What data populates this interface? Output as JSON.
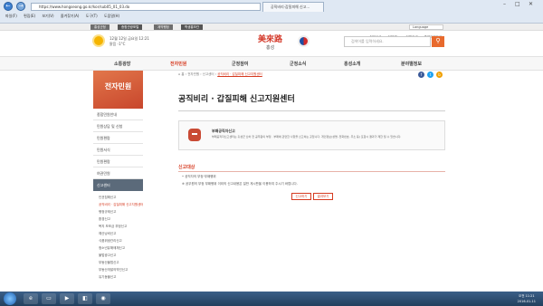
{
  "browser": {
    "back": "←",
    "forward": "→",
    "address": "https://www.hongseong.go.kr/kor/sub05_01_03.do",
    "tab_title": "공직비리·갑질피해 신고...",
    "min": "–",
    "max": "□",
    "close": "✕",
    "menu": [
      "파일(F)",
      "편집(E)",
      "보기(V)",
      "즐겨찾기(A)",
      "도구(T)",
      "도움말(H)"
    ]
  },
  "utilbar": {
    "links": [
      "홍성군청",
      "종합관광포털",
      "계약행정",
      "학생홍보관"
    ],
    "language": "Language"
  },
  "header": {
    "weather_date": "12월 12일 금요일 12:21",
    "weather_temp": "맑음 -1°C",
    "logo_main": "美來路",
    "logo_sub": "홍성",
    "top_links": [
      "처음으로",
      "전체메뉴",
      "직원검색",
      "홈페이지안내"
    ],
    "search_placeholder": "검색어를 입력하세요.",
    "search_icon": "⚲"
  },
  "gnb": [
    "소통광장",
    "전자민원",
    "군정참여",
    "군정소식",
    "홍성소개",
    "분야별정보"
  ],
  "side": {
    "hero_title": "전자민원",
    "menu": [
      "종합민원안내",
      "민원상담 및 신청",
      "민원편람",
      "민원서식",
      "민원편람",
      "여권민원",
      "신고센터"
    ],
    "active_index": 6,
    "sub": [
      "인권침해신고",
      "공직비리 · 갑질피해 신고지원센터",
      "행정규제신고",
      "환경신고",
      "복지 보조금 부정신고",
      "예산낭비신고",
      "식품위생관리신고",
      "청소년유해매체신고",
      "불법광고신고",
      "부동산불법신고",
      "부동산개발의약건신고",
      "유기동물신고"
    ],
    "sub_active_index": 1
  },
  "content": {
    "crumbs": [
      "홈",
      "전자민원",
      "신고센터",
      "공직비리 · 갑질피해 신고지원센터"
    ],
    "title": "공직비리 · 갑질피해 신고지원센터",
    "box_title": "부패공직자신고",
    "box_desc": "부패공직자신고센터는 홍성군 산하 전 공무원의 부정 · 부패에 관련한 사항을 신고하는 곳입니다. 개인정보(성명, 전화번호, 주소 등) 포함시 결과가 제한 될 수 있습니다.",
    "section_head": "신고대상",
    "bullets": [
      "공직자의 부정·부패행위",
      "공무원의 부정 부패행위 이외의 신고내용은 일반 게시판을 이용하여 주시기 바랍니다."
    ],
    "btn_write": "신고하기",
    "btn_result": "결과보기",
    "social": [
      "f",
      "t",
      "b"
    ]
  },
  "taskbar": {
    "time": "오전 11:21",
    "date": "2016-01-11"
  },
  "colors": {
    "accent": "#d63b21",
    "search_button": "#e86a2d"
  }
}
